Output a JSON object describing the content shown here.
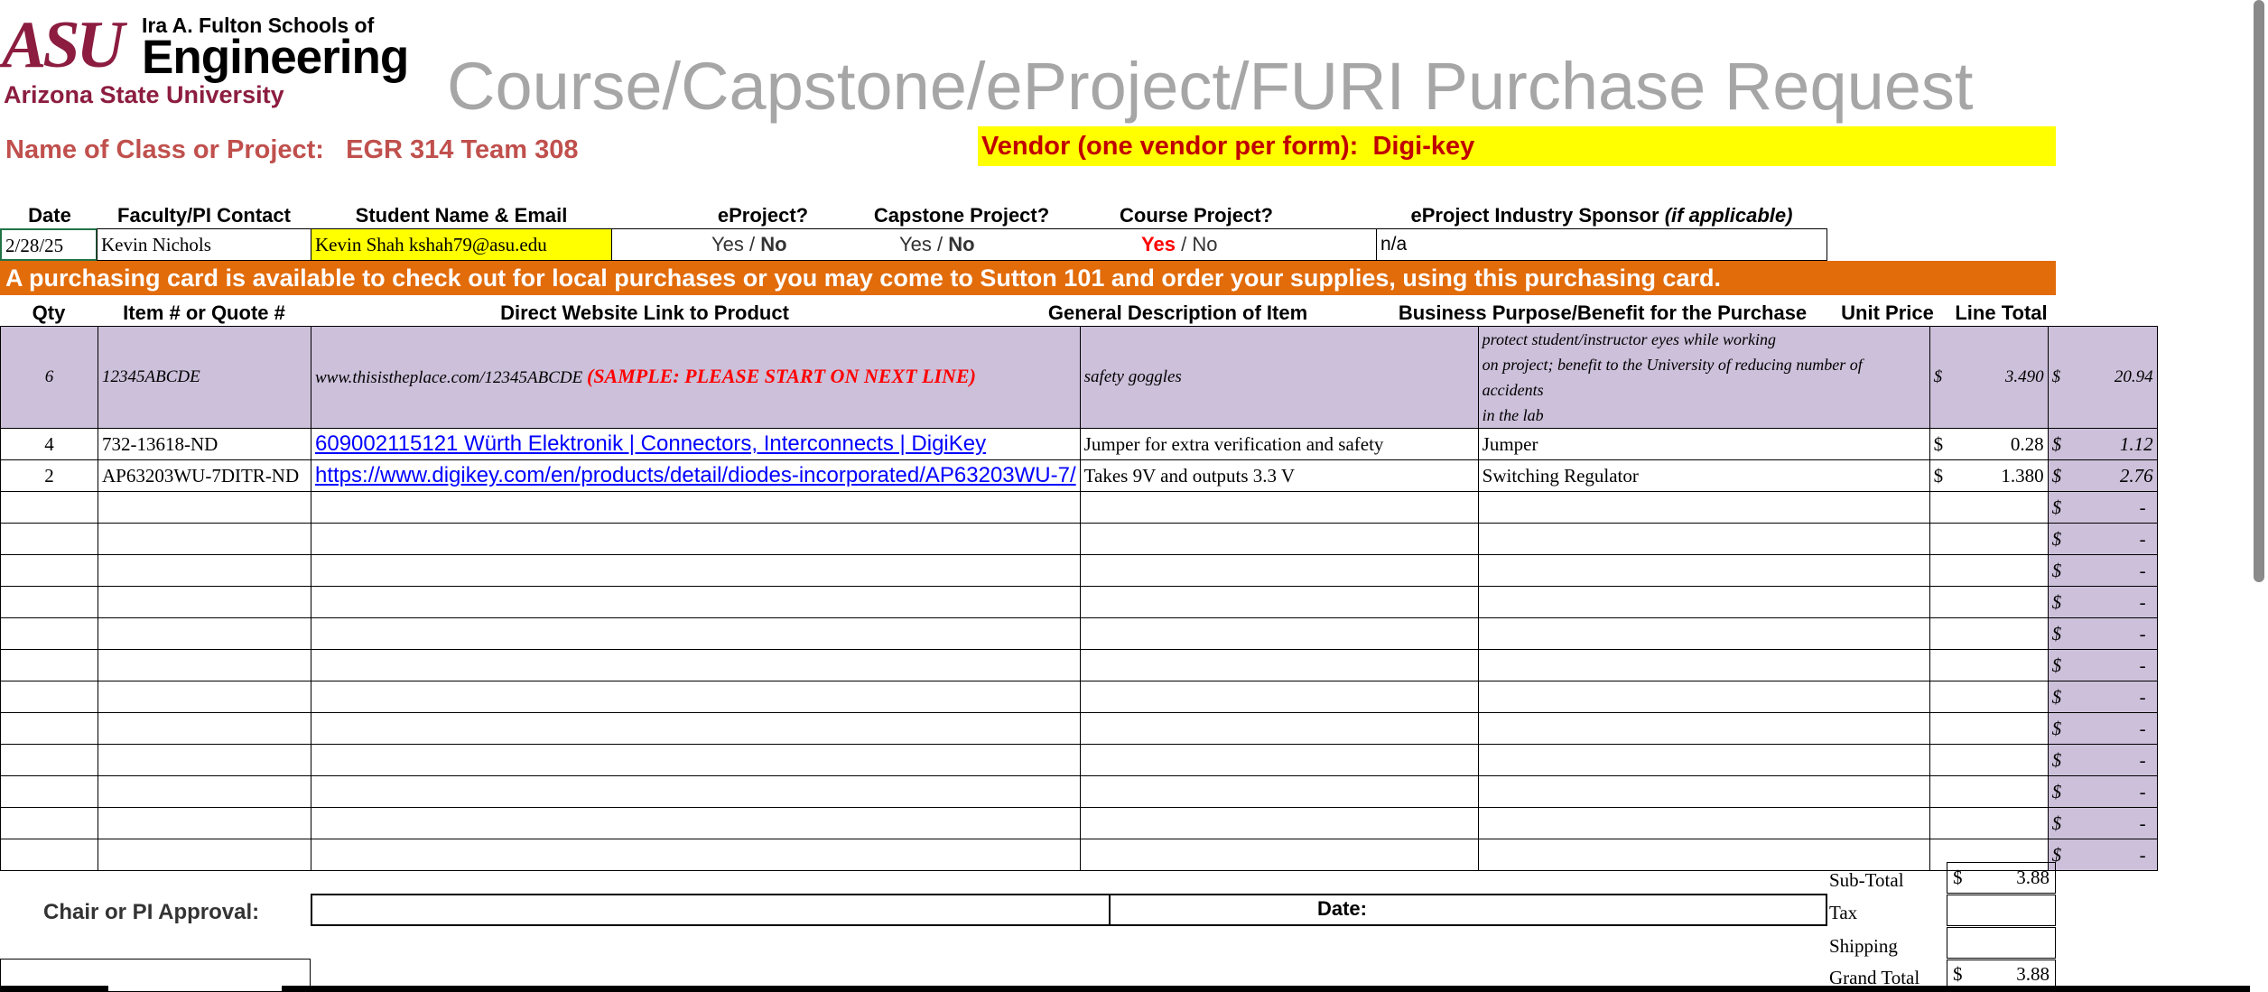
{
  "logo": {
    "asu": "ASU",
    "line1": "Ira A. Fulton Schools of",
    "line2": "Engineering",
    "line3": "Arizona State University"
  },
  "title": "Course/Capstone/eProject/FURI Purchase Request",
  "project": {
    "label": "Name of Class or Project:",
    "value": "EGR 314 Team 308"
  },
  "vendor": {
    "label": "Vendor (one vendor per form):",
    "value": "Digi-key"
  },
  "info_headers": {
    "date": "Date",
    "faculty": "Faculty/PI Contact",
    "student": "Student Name & Email",
    "eproject": "eProject?",
    "capstone": "Capstone Project?",
    "course": "Course Project?",
    "sponsor": "eProject Industry Sponsor",
    "sponsor_note": "(if applicable)"
  },
  "info_row": {
    "date": "2/28/25",
    "faculty": "Kevin Nichols",
    "student": "Kevin Shah kshah79@asu.edu",
    "eproject_yes": "Yes",
    "eproject_sep": "/",
    "eproject_no": "No",
    "capstone_yes": "Yes",
    "capstone_sep": "/",
    "capstone_no": "No",
    "course_yes": "Yes",
    "course_sep": "/",
    "course_no": "No",
    "sponsor": "n/a"
  },
  "banner": "A purchasing card is available to check out for local purchases or you may come to Sutton 101 and order your supplies, using this purchasing card.",
  "table_headers": {
    "qty": "Qty",
    "item": "Item # or Quote #",
    "link": "Direct Website Link to Product",
    "desc": "General Description of Item",
    "purpose": "Business Purpose/Benefit for the Purchase",
    "unit": "Unit Price",
    "total": "Line Total"
  },
  "sample_row": {
    "qty": "6",
    "item": "12345ABCDE",
    "link": "www.thisistheplace.com/12345ABCDE",
    "note": "(SAMPLE: PLEASE START ON NEXT LINE)",
    "desc": "safety goggles",
    "purpose_1": "protect student/instructor eyes while working",
    "purpose_2": "on project; benefit to the University of reducing number of accidents",
    "purpose_3": "in the lab",
    "currency": "$",
    "unit": "3.490",
    "total": "20.94"
  },
  "rows": [
    {
      "qty": "4",
      "item": "732-13618-ND",
      "link": "609002115121 Würth Elektronik | Connectors, Interconnects | DigiKey",
      "desc": "Jumper for extra verification and safety",
      "purpose": "Jumper",
      "unit": "0.28",
      "total": "1.12"
    },
    {
      "qty": "2",
      "item": "AP63203WU-7DITR-ND",
      "link": "https://www.digikey.com/en/products/detail/diodes-incorporated/AP63203WU-7/",
      "desc": "Takes 9V and outputs 3.3 V",
      "purpose": "Switching Regulator",
      "unit": "1.380",
      "total": "2.76"
    }
  ],
  "empty_total": "-",
  "currency": "$",
  "approval": {
    "label": "Chair or PI Approval:",
    "date_label": "Date:"
  },
  "totals": {
    "subtotal_label": "Sub-Total",
    "subtotal": "3.88",
    "tax_label": "Tax",
    "shipping_label": "Shipping",
    "grand_label": "Grand Total",
    "grand": "3.88"
  },
  "colors": {
    "asu_maroon": "#8c1d40",
    "asu_gold": "#ffc627",
    "banner_orange": "#e26b0a",
    "sample_purple": "#ccc0da",
    "vendor_yellow": "#ffff00",
    "highlight_red": "#ff0000"
  }
}
